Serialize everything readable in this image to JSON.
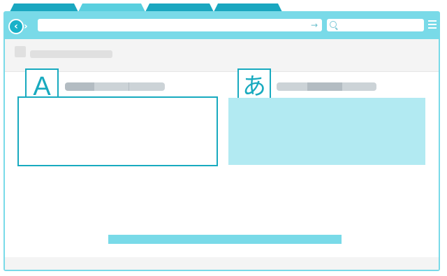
{
  "browser": {
    "tabs": [
      {
        "label": "",
        "active": false
      },
      {
        "label": "",
        "active": true
      },
      {
        "label": "",
        "active": false
      },
      {
        "label": "",
        "active": false
      }
    ],
    "nav": {
      "back_glyph": "‹",
      "forward_glyph": "›"
    },
    "address": {
      "value": "",
      "arrow_glyph": "→"
    },
    "search": {
      "value": ""
    }
  },
  "translator": {
    "source_language_glyph": "A",
    "target_language_glyph": "あ",
    "source_text": "",
    "target_text": ""
  },
  "colors": {
    "accent": "#18aabf",
    "toolbar": "#79dae8",
    "target_fill": "#b2eaf2",
    "tab_inactive": "#1aa7c0",
    "tab_active": "#59cfdf"
  }
}
